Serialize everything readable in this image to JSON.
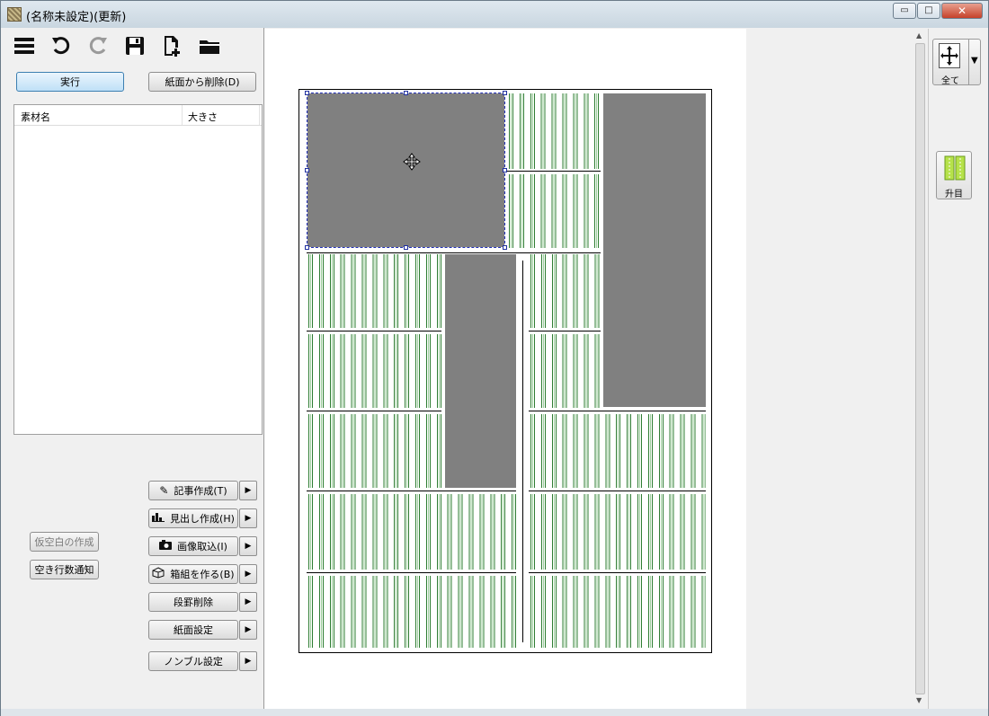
{
  "window": {
    "title": "(名称未設定)(更新)",
    "controls": {
      "minimize": "▭",
      "maximize": "□",
      "close": "✕"
    }
  },
  "toolbar": {
    "icons": [
      "menu-icon",
      "undo-icon",
      "redo-icon",
      "save-icon",
      "new-page-icon",
      "open-folder-icon"
    ]
  },
  "actions": {
    "run": "実行",
    "delete_from_page": "紙面から削除(D)"
  },
  "material_list": {
    "columns": [
      "素材名",
      "大きさ"
    ],
    "rows": []
  },
  "side_buttons": {
    "temp_blank": "仮空白の作成",
    "empty_lines": "空き行数通知"
  },
  "commands": [
    {
      "label": "記事作成(T)",
      "icon": "pencil-icon"
    },
    {
      "label": "見出し作成(H)",
      "icon": "bar-chart-icon"
    },
    {
      "label": "画像取込(I)",
      "icon": "camera-icon"
    },
    {
      "label": "箱組を作る(B)",
      "icon": "box-icon"
    },
    {
      "label": "段罫削除",
      "icon": ""
    },
    {
      "label": "紙面設定",
      "icon": ""
    },
    {
      "label": "ノンブル設定",
      "icon": ""
    }
  ],
  "right_panel": {
    "move_all": "全て",
    "grid_view": "升目"
  },
  "colors": {
    "grid_line": "#2e7d32",
    "image_block": "#808080",
    "selection": "#2230b8",
    "accent": "#3c7fb1"
  }
}
